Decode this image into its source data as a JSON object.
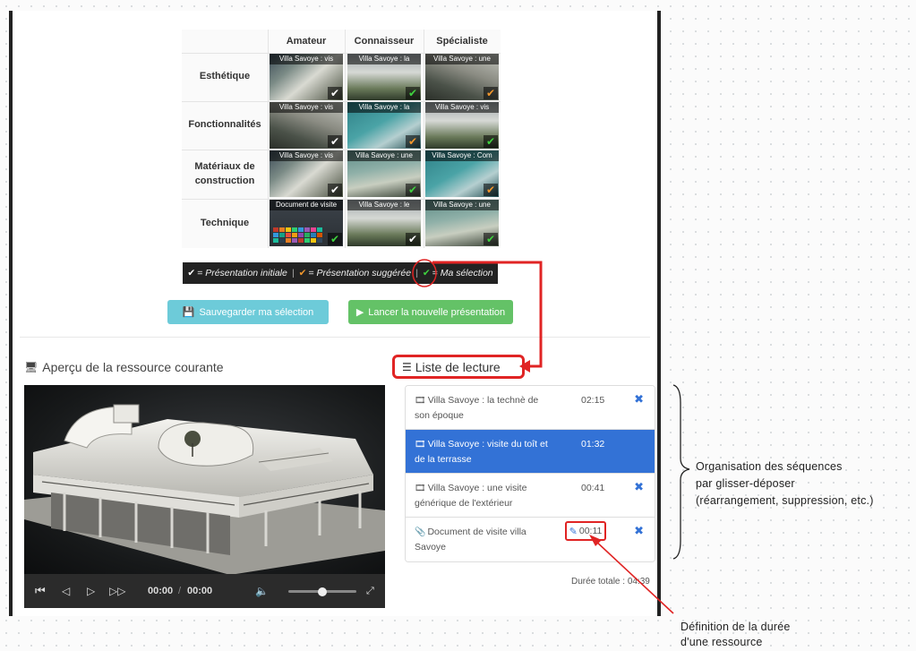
{
  "matrix": {
    "columns": [
      "Amateur",
      "Connaisseur",
      "Spécialiste"
    ],
    "rows": [
      {
        "label": "Esthétique",
        "cells": [
          {
            "caption": "Villa Savoye : vis",
            "check": "white"
          },
          {
            "caption": "Villa Savoye : la",
            "check": "green"
          },
          {
            "caption": "Villa Savoye : une",
            "check": "orange"
          }
        ]
      },
      {
        "label": "Fonctionnalités",
        "cells": [
          {
            "caption": "Villa Savoye : vis",
            "check": "white"
          },
          {
            "caption": "Villa Savoye : la",
            "check": "orange"
          },
          {
            "caption": "Villa Savoye : vis",
            "check": "green"
          }
        ]
      },
      {
        "label": "Matériaux de construction",
        "cells": [
          {
            "caption": "Villa Savoye : vis",
            "check": "white"
          },
          {
            "caption": "Villa Savoye : une",
            "check": "green"
          },
          {
            "caption": "Villa Savoye : Com",
            "check": "orange"
          }
        ]
      },
      {
        "label": "Technique",
        "cells": [
          {
            "caption": "Document de visite",
            "check": "green"
          },
          {
            "caption": "Villa Savoye : le",
            "check": "white"
          },
          {
            "caption": "Villa Savoye : une",
            "check": "green"
          }
        ]
      }
    ]
  },
  "legend": {
    "initial": "= Présentation initiale",
    "suggested": "= Présentation suggérée",
    "selection": "= Ma sélection",
    "separator": "|"
  },
  "buttons": {
    "save": "Sauvegarder ma sélection",
    "launch": "Lancer la nouvelle présentation"
  },
  "preview": {
    "title": "Aperçu de la ressource courante",
    "current_time": "00:00",
    "time_separator": "/",
    "duration": "00:00"
  },
  "playlist": {
    "title": "Liste de lecture",
    "items": [
      {
        "title": "Villa Savoye : la technè de son époque",
        "time": "02:15",
        "type": "video",
        "active": false
      },
      {
        "title": "Villa Savoye : visite du toît et de la terrasse",
        "time": "01:32",
        "type": "video",
        "active": true
      },
      {
        "title": "Villa Savoye : une visite générique de l'extérieur",
        "time": "00:41",
        "type": "video",
        "active": false
      },
      {
        "title": "Document de visite villa Savoye",
        "time": "00:11",
        "type": "document",
        "active": false
      }
    ],
    "total": "Durée totale : 04:39"
  },
  "annotations": {
    "organisation": [
      "Organisation des séquences",
      "par glisser-déposer",
      "(réarrangement, suppression, etc.)"
    ],
    "duree": [
      "Définition de la durée",
      "d'une ressource"
    ]
  },
  "colors": {
    "accent_red": "#e02424",
    "save_button": "#6dcbd9",
    "launch_button": "#64c267",
    "active_item": "#3372d6",
    "check_orange": "#f0962c",
    "check_green": "#3fd13f"
  }
}
